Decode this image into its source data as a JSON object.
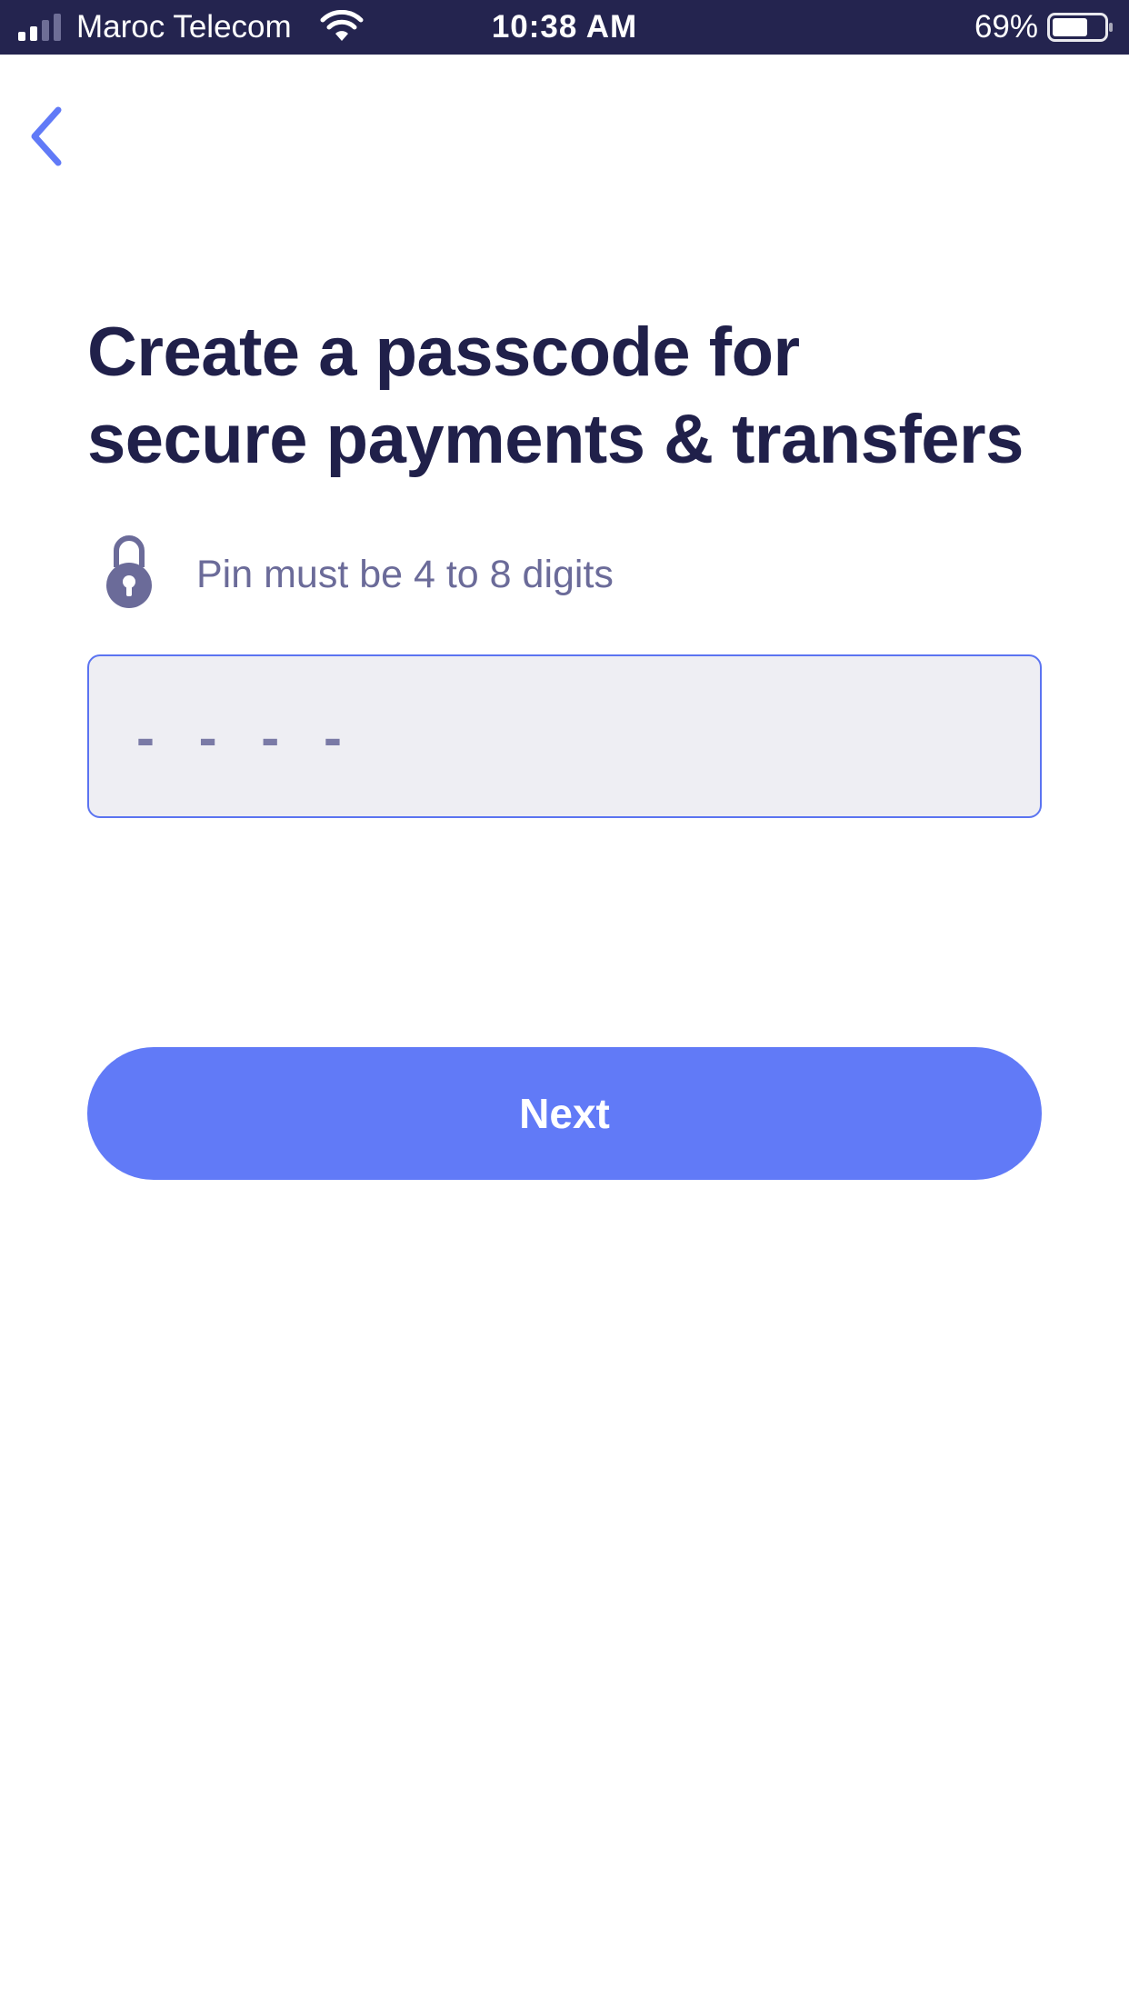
{
  "status_bar": {
    "carrier": "Maroc Telecom",
    "time": "10:38 AM",
    "battery_percent": "69%",
    "signal_icon": "cellular-signal-icon",
    "wifi_icon": "wifi-icon",
    "battery_icon": "battery-icon",
    "battery_level": 0.69
  },
  "nav": {
    "back_icon": "chevron-left-icon"
  },
  "title_lines": [
    "Create a passcode for",
    "secure payments & transfers"
  ],
  "hint": {
    "icon": "lock-icon",
    "text": "Pin must be 4 to 8 digits"
  },
  "pin_input": {
    "placeholder": "- - - -",
    "value": ""
  },
  "next_button": {
    "label": "Next"
  },
  "colors": {
    "status_bar_bg": "#24244f",
    "accent": "#617af7",
    "title": "#20204a",
    "hint_text": "#6b6b99",
    "input_bg": "#eeeef3",
    "input_border": "#5b74f1"
  }
}
